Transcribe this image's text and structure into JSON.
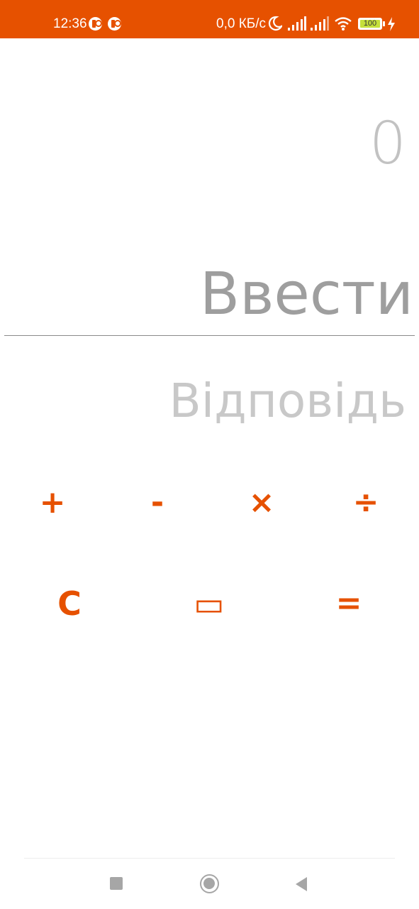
{
  "status_bar": {
    "time": "12:36",
    "network_speed": "0,0 КБ/с",
    "battery": "100",
    "icons": [
      "notification-badge-icon",
      "notification-badge-icon",
      "moon-icon",
      "signal-icon",
      "signal-icon",
      "wifi-icon",
      "battery-icon",
      "charging-bolt-icon"
    ],
    "background_color": "#e65100"
  },
  "display": {
    "top_value": "0",
    "input_placeholder": "Ввести",
    "input_value": "",
    "answer": "Відповідь"
  },
  "keys": {
    "plus": "+",
    "minus": "-",
    "multiply": "×",
    "divide": "÷",
    "clear": "C",
    "rectangle": "▭",
    "equals": "="
  },
  "colors": {
    "accent": "#e65100",
    "input_text": "#9e9e9e",
    "muted_text": "#c2c2c2"
  },
  "nav_bar": {
    "icons": [
      "square-recents-icon",
      "circle-home-icon",
      "triangle-back-icon"
    ]
  }
}
